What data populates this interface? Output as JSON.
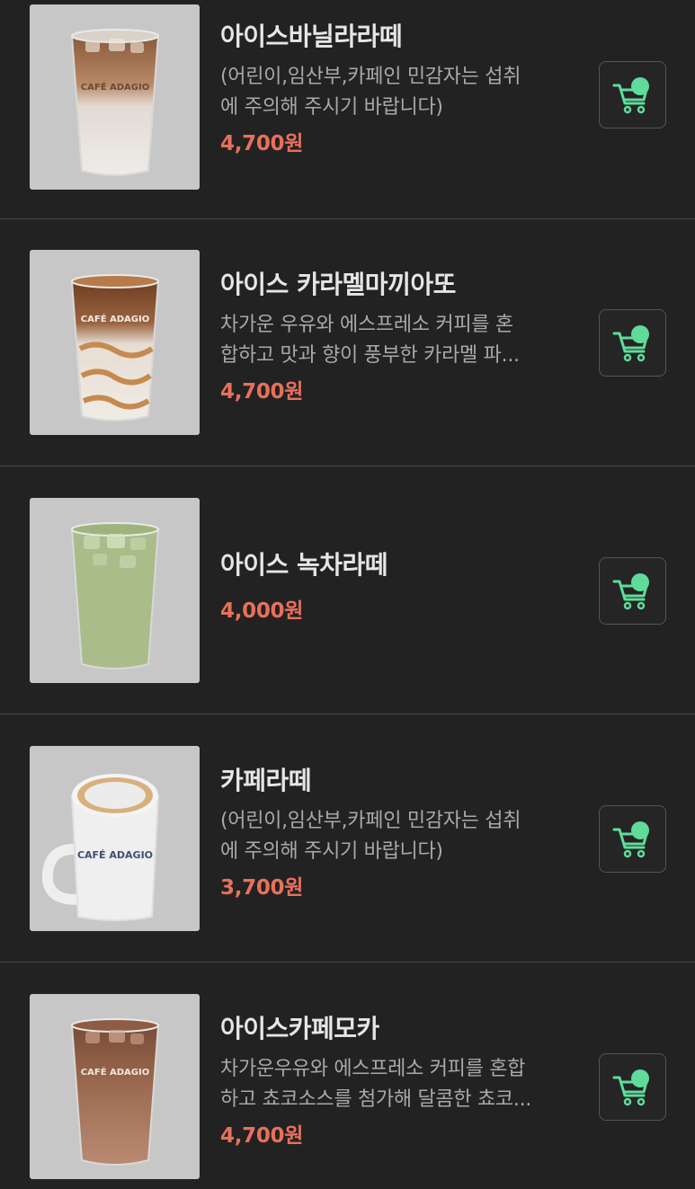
{
  "menu": {
    "items": [
      {
        "name": "아이스바닐라라떼",
        "desc_line1": "(어린이,임산부,카페인 민감자는 섭취",
        "desc_line2": "에 주의해 주시기 바랍니다)",
        "price": "4,700원",
        "image_type": "iced-cup-layered",
        "cart_icon": "cart-plus-icon"
      },
      {
        "name": "아이스 카라멜마끼아또",
        "desc_line1": "차가운 우유와 에스프레소 커피를 혼",
        "desc_line2": "합하고 맛과 향이 풍부한 카라멜 파...",
        "price": "4,700원",
        "image_type": "iced-cup-caramel",
        "cart_icon": "cart-plus-icon"
      },
      {
        "name": "아이스 녹차라떼",
        "price": "4,000원",
        "image_type": "iced-cup-green",
        "cart_icon": "cart-plus-icon"
      },
      {
        "name": "카페라떼",
        "desc_line1": "(어린이,임산부,카페인 민감자는 섭취",
        "desc_line2": "에 주의해 주시기 바랍니다)",
        "price": "3,700원",
        "image_type": "hot-mug",
        "cart_icon": "cart-plus-icon"
      },
      {
        "name": "아이스카페모카",
        "desc_line1": "차가운우유와 에스프레소 커피를 혼합",
        "desc_line2": "하고 쵸코소스를 첨가해 달콤한 쵸코...",
        "price": "4,700원",
        "image_type": "iced-cup-mocha",
        "cart_icon": "cart-plus-icon"
      }
    ],
    "image_brand_text": "CAFÉ ADAGIO",
    "colors": {
      "background": "#222222",
      "price": "#e8705b",
      "cart_accent": "#5fdc9a",
      "name": "#e6e6e6",
      "desc": "#a9a9a9"
    }
  }
}
